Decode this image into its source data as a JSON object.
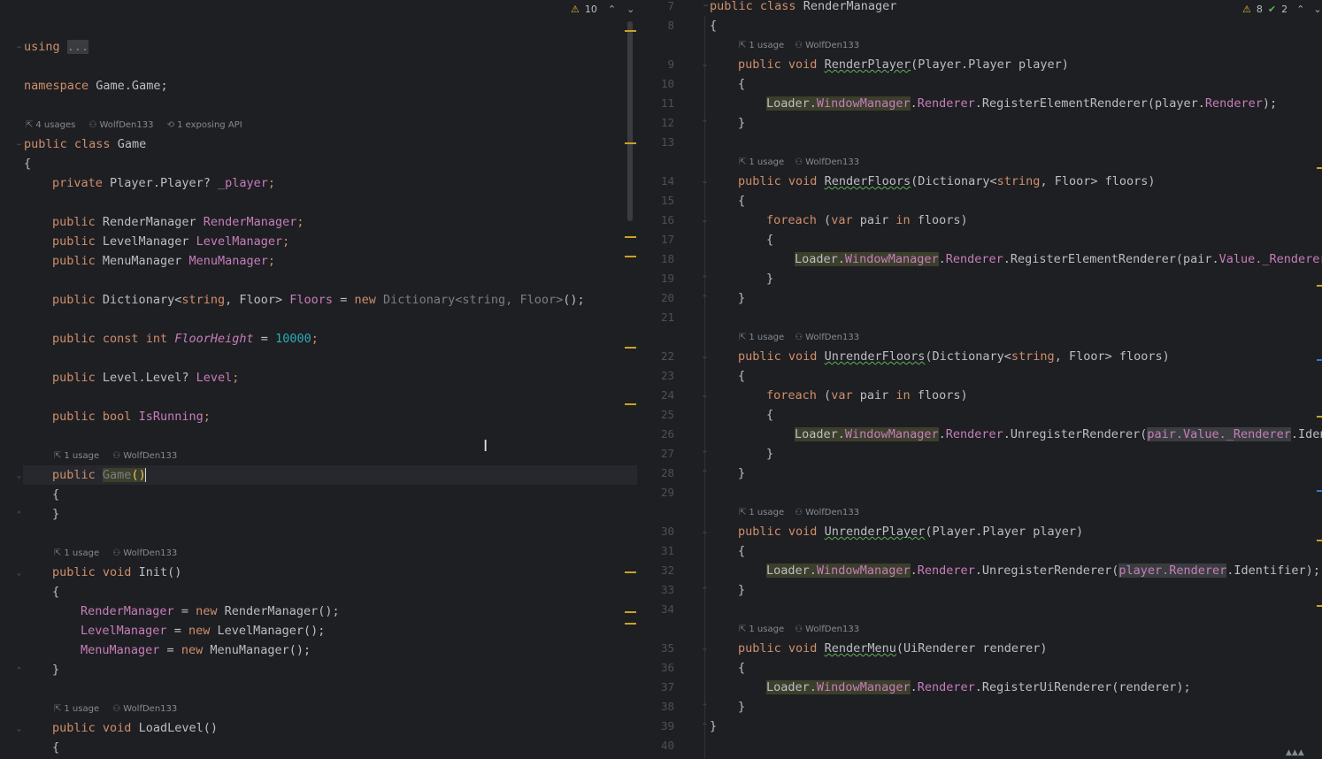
{
  "left": {
    "indicators": {
      "warnings": "10"
    },
    "hints": {
      "class": {
        "usages": "4 usages",
        "author": "WolfDen133",
        "api": "1 exposing API"
      },
      "member": {
        "usages": "1 usage",
        "author": "WolfDen133"
      }
    },
    "code": {
      "using": "using",
      "using_fold": "...",
      "namespace_kw": "namespace",
      "namespace_name": "Game.Game;",
      "public": "public",
      "class": "class",
      "class_name": "Game",
      "open_brace": "{",
      "close_brace": "}",
      "private": "private",
      "player_type": "Player.Player?",
      "player_field": "_player",
      "semi": ";",
      "render_type": "RenderManager",
      "render_field": "RenderManager",
      "level_mgr_type": "LevelManager",
      "level_mgr_field": "LevelManager",
      "menu_type": "MenuManager",
      "menu_field": "MenuManager",
      "dict_type": "Dictionary<",
      "string": "string",
      "floor_part": ", Floor>",
      "floors_field": "Floors",
      "assign": "=",
      "new": "new",
      "dict_init": "Dictionary<string, Floor>",
      "paren_semi": "();",
      "const": "const",
      "int": "int",
      "floor_height": "FloorHeight",
      "floor_value": "10000",
      "level_type": "Level.Level?",
      "level_field": "Level",
      "bool": "bool",
      "running_field": "IsRunning",
      "ctor_name": "Game",
      "ctor_parens": "()",
      "void": "void",
      "init_name": "Init",
      "parens": "()",
      "render_ctor": "RenderManager",
      "level_ctor": "LevelManager",
      "menu_ctor": "MenuManager",
      "load_level": "LoadLevel"
    }
  },
  "right": {
    "indicators": {
      "warnings": "8",
      "checks": "2"
    },
    "hints": {
      "usages": "1 usage",
      "author": "WolfDen133"
    },
    "line_numbers": [
      "7",
      "8",
      "9",
      "10",
      "11",
      "12",
      "13",
      "14",
      "15",
      "16",
      "17",
      "18",
      "19",
      "20",
      "21",
      "22",
      "23",
      "24",
      "25",
      "26",
      "27",
      "28",
      "29",
      "30",
      "31",
      "32",
      "33",
      "34",
      "35",
      "36",
      "37",
      "38",
      "39",
      "40"
    ],
    "code": {
      "public": "public",
      "class": "class",
      "class_name": "RenderManager",
      "open_brace": "{",
      "close_brace": "}",
      "void": "void",
      "render_player": "RenderPlayer",
      "player_params": "(Player.Player player)",
      "loader": "Loader",
      "dot": ".",
      "window_manager": "WindowManager",
      "renderer": "Renderer",
      "register_element": "RegisterElementRenderer",
      "player_renderer_call_open": "(player.",
      "player_renderer_close": ");",
      "render_floors": "RenderFloors",
      "dict_open": "(Dictionary<",
      "string": "string",
      "floor_params": ", Floor> floors)",
      "foreach": "foreach",
      "var_open": "(",
      "var": "var",
      "pair": " pair ",
      "in": "in",
      "floors_close": " floors)",
      "pair_open": "(pair.",
      "value": "Value",
      "dot_renderer": "._Renderer",
      "close_paren": ")",
      "unrender_floors": "UnrenderFloors",
      "unregister": "UnregisterRenderer",
      "paren": "(",
      "pair_value_renderer": "pair.Value._Renderer",
      "iden": ".Iden",
      "unrender_player": "UnrenderPlayer",
      "player_renderer": "player.Renderer",
      "identifier_close": ".Identifier);",
      "render_menu": "RenderMenu",
      "ui_params": "(UiRenderer renderer)",
      "register_ui": "RegisterUiRenderer",
      "renderer_close": "(renderer);"
    }
  },
  "colors": {
    "background": "#1e1f22",
    "keyword": "#cf8e6d",
    "member": "#c77dbb",
    "number": "#2aacb8",
    "warning": "#e8b339"
  }
}
